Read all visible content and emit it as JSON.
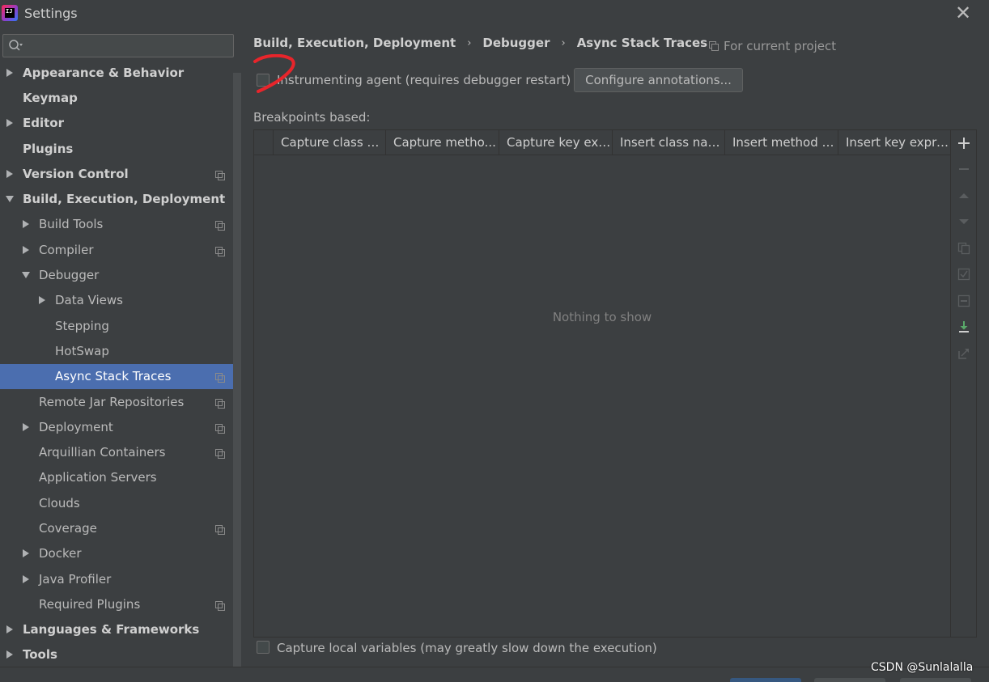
{
  "window": {
    "title": "Settings",
    "app_icon": "intellij-idea-icon",
    "close_glyph": "✕"
  },
  "search": {
    "value": "",
    "placeholder": ""
  },
  "tree": [
    {
      "label": "Appearance & Behavior",
      "level": 0,
      "arrow": "collapsed",
      "bold": true,
      "project": false
    },
    {
      "label": "Keymap",
      "level": 0,
      "arrow": "none",
      "bold": true,
      "project": false
    },
    {
      "label": "Editor",
      "level": 0,
      "arrow": "collapsed",
      "bold": true,
      "project": false
    },
    {
      "label": "Plugins",
      "level": 0,
      "arrow": "none",
      "bold": true,
      "project": false
    },
    {
      "label": "Version Control",
      "level": 0,
      "arrow": "collapsed",
      "bold": true,
      "project": true
    },
    {
      "label": "Build, Execution, Deployment",
      "level": 0,
      "arrow": "expanded",
      "bold": true,
      "project": false
    },
    {
      "label": "Build Tools",
      "level": 1,
      "arrow": "collapsed",
      "bold": false,
      "project": true
    },
    {
      "label": "Compiler",
      "level": 1,
      "arrow": "collapsed",
      "bold": false,
      "project": true
    },
    {
      "label": "Debugger",
      "level": 1,
      "arrow": "expanded",
      "bold": false,
      "project": false
    },
    {
      "label": "Data Views",
      "level": 2,
      "arrow": "collapsed",
      "bold": false,
      "project": false
    },
    {
      "label": "Stepping",
      "level": 2,
      "arrow": "none",
      "bold": false,
      "project": false
    },
    {
      "label": "HotSwap",
      "level": 2,
      "arrow": "none",
      "bold": false,
      "project": false
    },
    {
      "label": "Async Stack Traces",
      "level": 2,
      "arrow": "none",
      "bold": false,
      "project": true,
      "selected": true
    },
    {
      "label": "Remote Jar Repositories",
      "level": 1,
      "arrow": "none",
      "bold": false,
      "project": true
    },
    {
      "label": "Deployment",
      "level": 1,
      "arrow": "collapsed",
      "bold": false,
      "project": true
    },
    {
      "label": "Arquillian Containers",
      "level": 1,
      "arrow": "none",
      "bold": false,
      "project": true
    },
    {
      "label": "Application Servers",
      "level": 1,
      "arrow": "none",
      "bold": false,
      "project": false
    },
    {
      "label": "Clouds",
      "level": 1,
      "arrow": "none",
      "bold": false,
      "project": false
    },
    {
      "label": "Coverage",
      "level": 1,
      "arrow": "none",
      "bold": false,
      "project": true
    },
    {
      "label": "Docker",
      "level": 1,
      "arrow": "collapsed",
      "bold": false,
      "project": false
    },
    {
      "label": "Java Profiler",
      "level": 1,
      "arrow": "collapsed",
      "bold": false,
      "project": false
    },
    {
      "label": "Required Plugins",
      "level": 1,
      "arrow": "none",
      "bold": false,
      "project": true
    },
    {
      "label": "Languages & Frameworks",
      "level": 0,
      "arrow": "collapsed",
      "bold": true,
      "project": false
    },
    {
      "label": "Tools",
      "level": 0,
      "arrow": "collapsed",
      "bold": true,
      "project": false
    }
  ],
  "breadcrumb": {
    "items": [
      "Build, Execution, Deployment",
      "Debugger",
      "Async Stack Traces"
    ],
    "separator": "›"
  },
  "for_project": "For current project",
  "instrumenting": {
    "label": "Instrumenting agent (requires debugger restart)",
    "checked": false
  },
  "configure_button": "Configure annotations...",
  "breakpoints_label": "Breakpoints based:",
  "table": {
    "columns": [
      "Capture class na...",
      "Capture metho...",
      "Capture key exp...",
      "Insert class name",
      "Insert method n...",
      "Insert key expre..."
    ],
    "empty_text": "Nothing to show"
  },
  "toolbar_icons": [
    "add-icon",
    "remove-icon",
    "move-up-icon",
    "move-down-icon",
    "copy-icon",
    "enable-all-icon",
    "disable-all-icon",
    "import-icon",
    "export-icon"
  ],
  "capture_local": {
    "label": "Capture local variables (may greatly slow down the execution)",
    "checked": false
  },
  "watermark": "CSDN @Sunlalalla",
  "colors": {
    "selection": "#4b6eaf",
    "background": "#3c3f41",
    "annotation": "#e8252b",
    "import_icon": "#59a869"
  }
}
